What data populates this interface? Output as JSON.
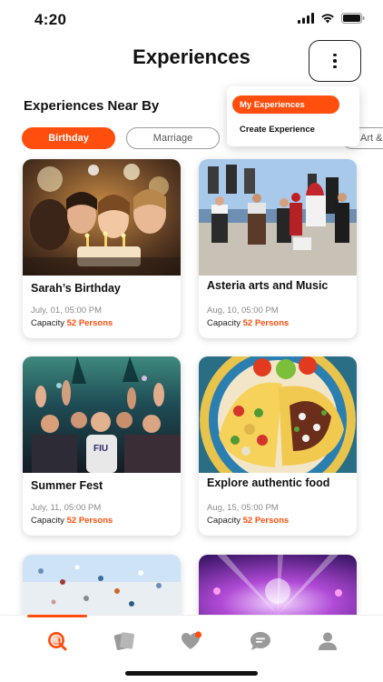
{
  "status_bar": {
    "time": "4:20"
  },
  "header": {
    "title": "Experiences",
    "menu_icon": "more-vertical-icon"
  },
  "dropdown": {
    "items": [
      "My Experiences",
      "Create Experience"
    ]
  },
  "section": {
    "title": "Experiences Near By"
  },
  "filters": {
    "chips": [
      "Birthday",
      "Marriage",
      "Art &"
    ],
    "active": "Birthday"
  },
  "cards": [
    {
      "title": "Sarah’s Birthday",
      "date": "July, 01, 05:00 PM",
      "capacity_label": "Capacity",
      "capacity_value": "52 Persons"
    },
    {
      "title": "Asteria arts and Music",
      "date": "Aug, 10, 05:00 PM",
      "capacity_label": "Capacity",
      "capacity_value": "52 Persons"
    },
    {
      "title": "Summer Fest",
      "date": "July, 11, 05:00 PM",
      "capacity_label": "Capacity",
      "capacity_value": "52 Persons"
    },
    {
      "title": "Explore authentic food",
      "date": "Aug, 15, 05:00 PM",
      "capacity_label": "Capacity",
      "capacity_value": "52 Persons"
    }
  ],
  "tab_bar": {
    "tabs": [
      "explore-icon",
      "cards-icon",
      "heart-notification-icon",
      "chat-icon",
      "profile-icon"
    ],
    "active": "explore-icon"
  },
  "colors": {
    "accent": "#ff4e0e",
    "text": "#111111",
    "muted": "#8a8a8a"
  }
}
